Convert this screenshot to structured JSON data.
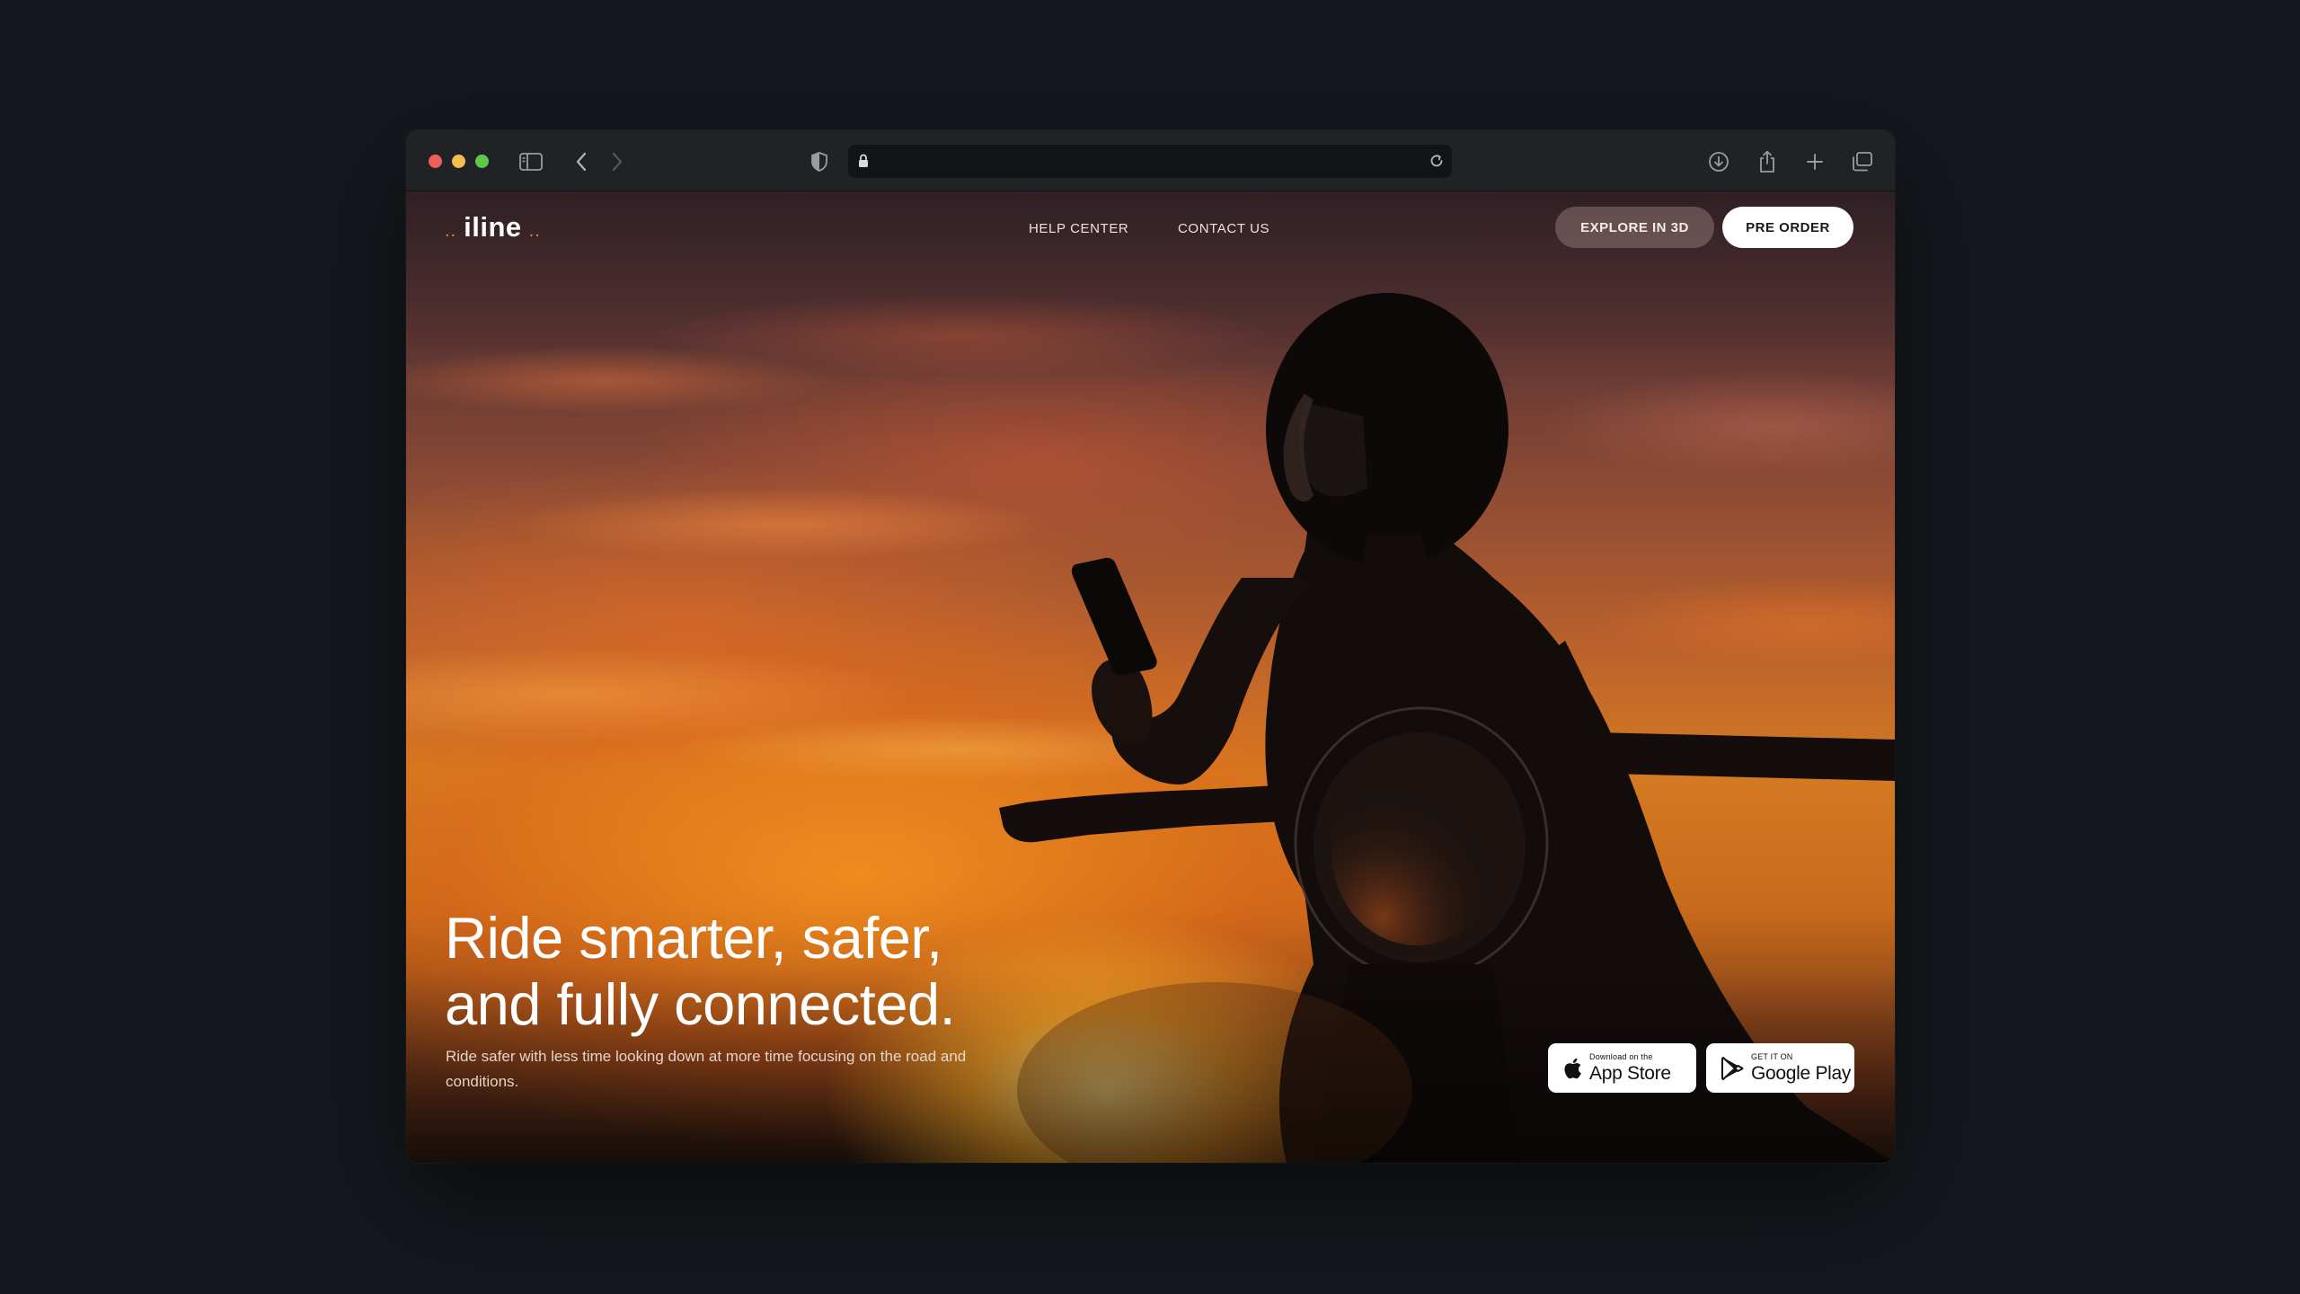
{
  "browser": {
    "url": "",
    "toolbar_icons": [
      "sidebar-icon",
      "back-icon",
      "forward-icon",
      "shield-icon",
      "lock-icon",
      "reload-icon",
      "download-icon",
      "share-icon",
      "new-tab-icon",
      "tabs-overview-icon"
    ]
  },
  "header": {
    "logo_dots_left": "..",
    "logo_name": "iline",
    "logo_dots_right": "..",
    "nav": [
      {
        "label": "HELP CENTER"
      },
      {
        "label": "CONTACT US"
      }
    ],
    "explore_label": "EXPLORE IN 3D",
    "preorder_label": "PRE ORDER"
  },
  "hero": {
    "headline_line1": "Ride smarter, safer,",
    "headline_line2": "and fully connected.",
    "subtext": "Ride safer with less time looking down at more time focusing on the road and conditions."
  },
  "badges": {
    "appstore_small": "Download on the",
    "appstore_big": "App Store",
    "googleplay_small": "GET IT ON",
    "googleplay_big": "Google Play"
  },
  "colors": {
    "accent": "#f08a2c",
    "page_background": "#15181d",
    "toolbar": "#212226"
  }
}
